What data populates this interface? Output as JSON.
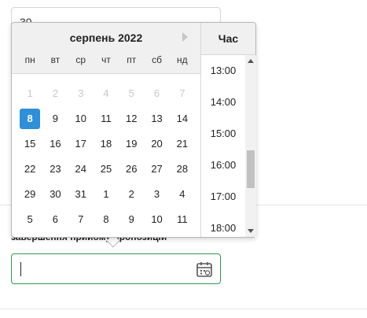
{
  "background": {
    "top_input_value": "30",
    "field_label": "завершення прийому пропозицій"
  },
  "datepicker": {
    "month_title": "серпень 2022",
    "weekdays": [
      "пн",
      "вт",
      "ср",
      "чт",
      "пт",
      "сб",
      "нд"
    ],
    "weeks": [
      [
        {
          "d": "1",
          "muted": true
        },
        {
          "d": "2",
          "muted": true
        },
        {
          "d": "3",
          "muted": true
        },
        {
          "d": "4",
          "muted": true
        },
        {
          "d": "5",
          "muted": true
        },
        {
          "d": "6",
          "muted": true
        },
        {
          "d": "7",
          "muted": true
        }
      ],
      [
        {
          "d": "8",
          "selected": true
        },
        {
          "d": "9"
        },
        {
          "d": "10"
        },
        {
          "d": "11"
        },
        {
          "d": "12"
        },
        {
          "d": "13"
        },
        {
          "d": "14"
        }
      ],
      [
        {
          "d": "15"
        },
        {
          "d": "16"
        },
        {
          "d": "17"
        },
        {
          "d": "18"
        },
        {
          "d": "19"
        },
        {
          "d": "20"
        },
        {
          "d": "21"
        }
      ],
      [
        {
          "d": "22"
        },
        {
          "d": "23"
        },
        {
          "d": "24"
        },
        {
          "d": "25"
        },
        {
          "d": "26"
        },
        {
          "d": "27"
        },
        {
          "d": "28"
        }
      ],
      [
        {
          "d": "29"
        },
        {
          "d": "30"
        },
        {
          "d": "31"
        },
        {
          "d": "1"
        },
        {
          "d": "2"
        },
        {
          "d": "3"
        },
        {
          "d": "4"
        }
      ],
      [
        {
          "d": "5"
        },
        {
          "d": "6"
        },
        {
          "d": "7"
        },
        {
          "d": "8"
        },
        {
          "d": "9"
        },
        {
          "d": "10"
        },
        {
          "d": "11"
        }
      ]
    ],
    "time_header": "Час",
    "times": [
      "13:00",
      "14:00",
      "15:00",
      "16:00",
      "17:00",
      "18:00"
    ]
  },
  "icons": {
    "next": "chevron-right-icon",
    "calendar": "calendar-icon"
  }
}
